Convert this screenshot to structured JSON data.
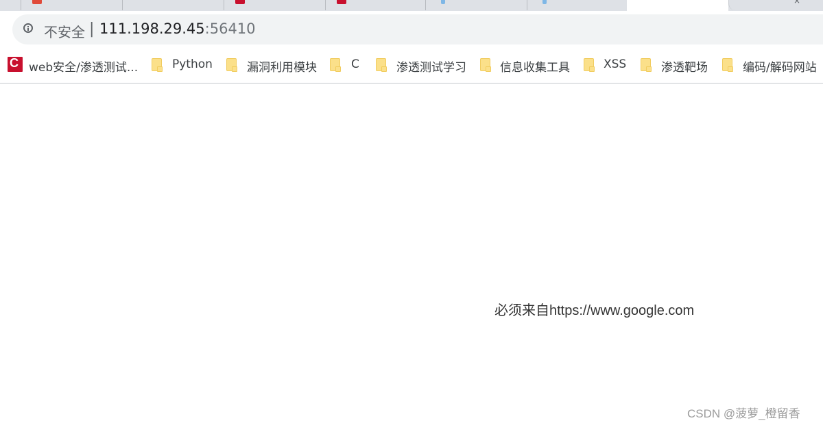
{
  "address_bar": {
    "security_label": "不安全",
    "separator": "|",
    "host": "111.198.29.45",
    "port": ":56410"
  },
  "bookmarks": [
    {
      "label": "web安全/渗透测试...",
      "icon": "csdn-icon"
    },
    {
      "label": "Python",
      "icon": "folder-icon"
    },
    {
      "label": "漏洞利用模块",
      "icon": "folder-icon"
    },
    {
      "label": "C",
      "icon": "folder-icon"
    },
    {
      "label": "渗透测试学习",
      "icon": "folder-icon"
    },
    {
      "label": "信息收集工具",
      "icon": "folder-icon"
    },
    {
      "label": "XSS",
      "icon": "folder-icon"
    },
    {
      "label": "渗透靶场",
      "icon": "folder-icon"
    },
    {
      "label": "编码/解码网站",
      "icon": "folder-icon"
    }
  ],
  "page": {
    "message": "必须来自https://www.google.com"
  },
  "watermark": "CSDN @菠萝_橙留香",
  "colors": {
    "tabstrip": "#dee1e6",
    "omnibox": "#f1f3f4",
    "folder": "#fbe08a",
    "csdn_red": "#c8102e"
  }
}
